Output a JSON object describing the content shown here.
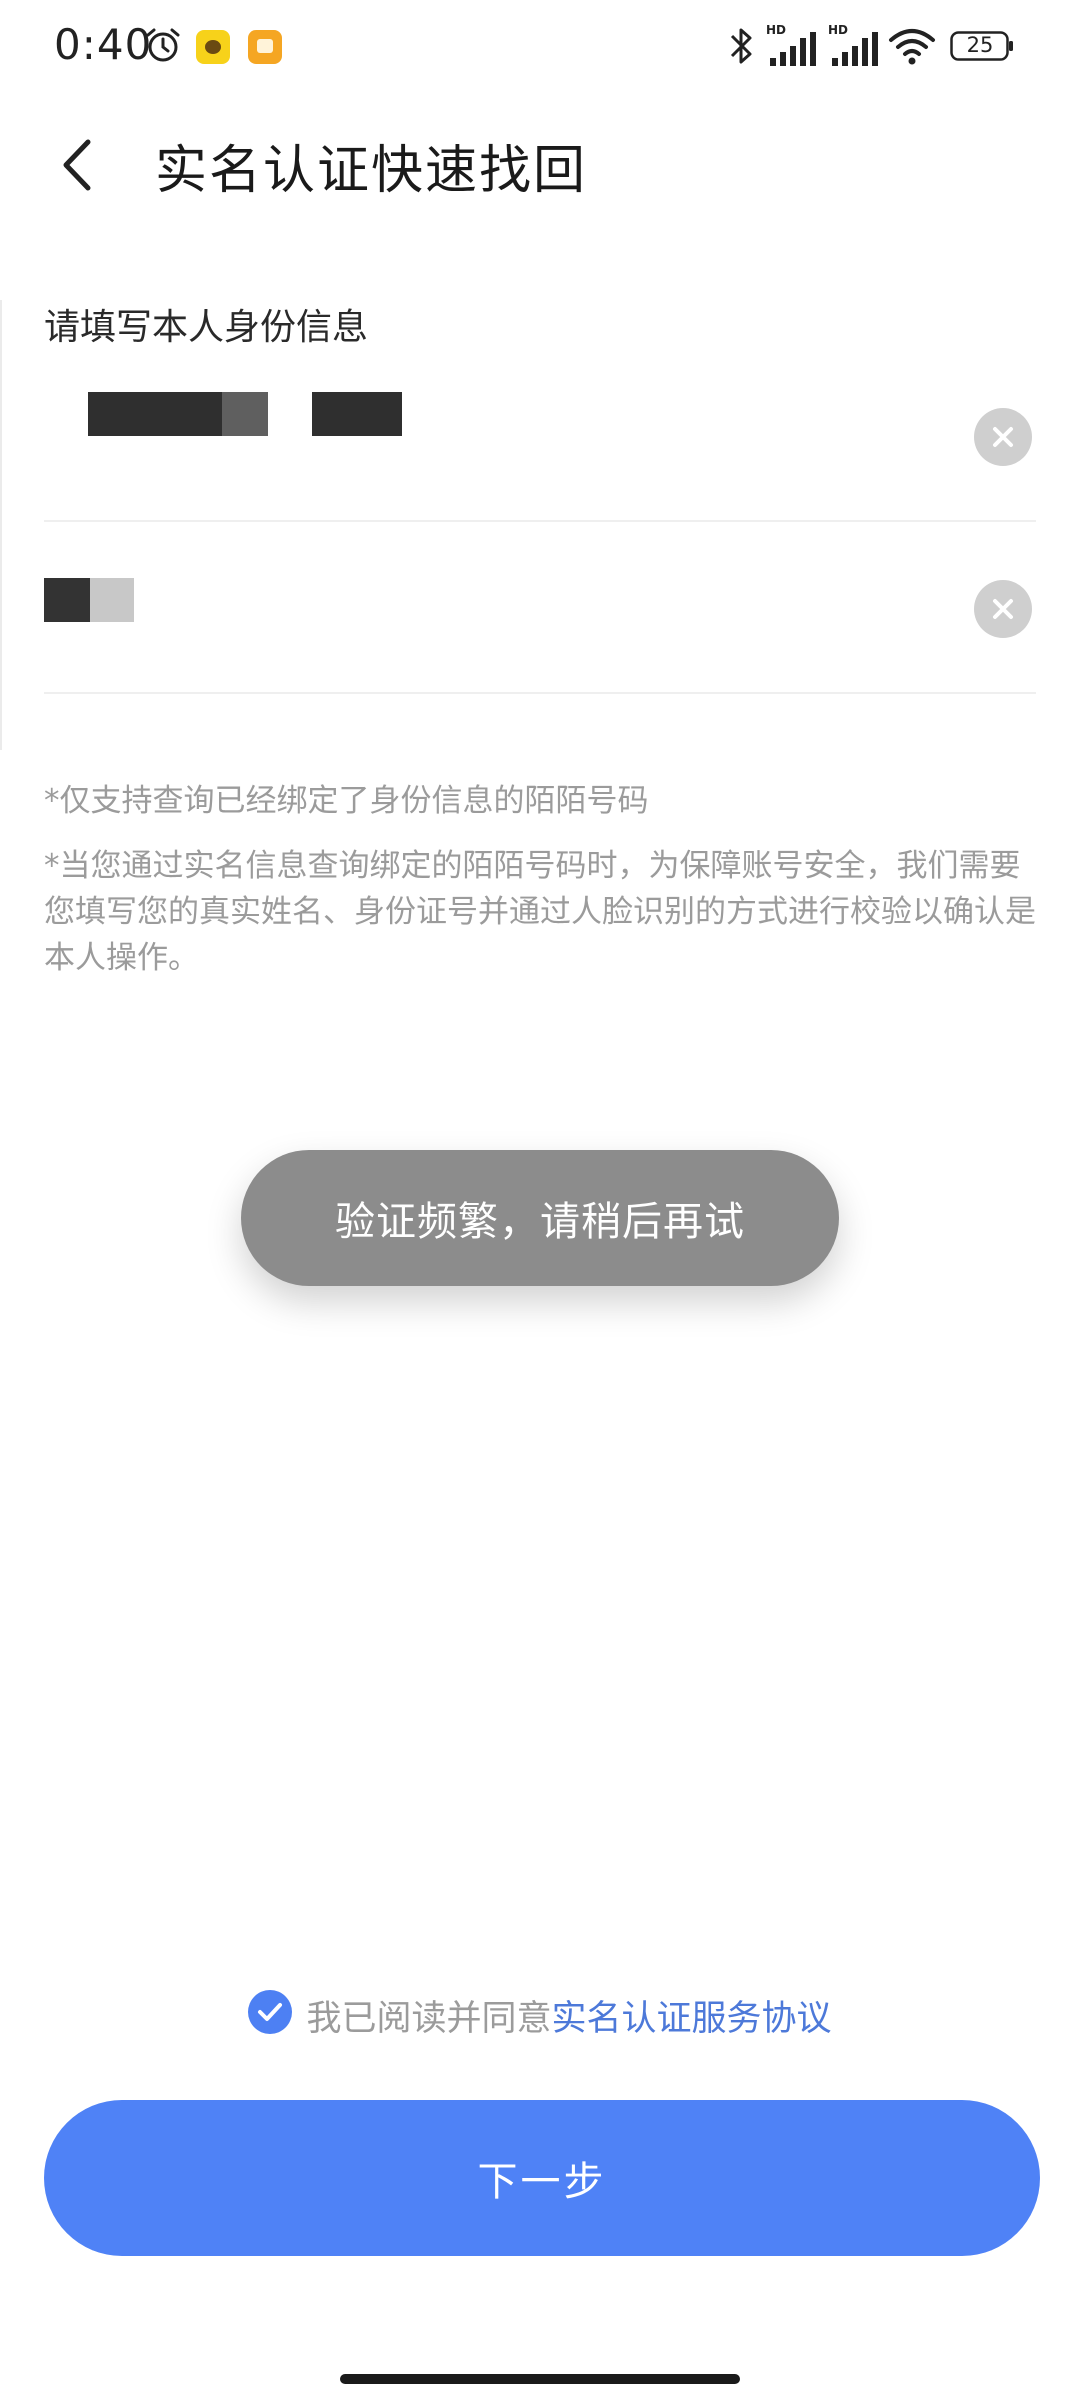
{
  "status_bar": {
    "time": "0:40",
    "battery": "25",
    "icons": [
      "alarm-icon",
      "app-notification-icon",
      "app-notification-icon",
      "bluetooth-icon",
      "hd-signal-icon",
      "hd-signal-icon",
      "wifi-icon",
      "battery-icon"
    ]
  },
  "header": {
    "title": "实名认证快速找回",
    "back_icon": "chevron-left-icon"
  },
  "form": {
    "section_label": "请填写本人身份信息",
    "name_field_state": "masked",
    "id_field_state": "masked",
    "clear_icon": "clear-icon"
  },
  "notes": [
    "*仅支持查询已经绑定了身份信息的陌陌号码",
    "*当您通过实名信息查询绑定的陌陌号码时，为保障账号安全，我们需要您填写您的真实姓名、身份证号并通过人脸识别的方式进行校验以确认是本人操作。"
  ],
  "toast": {
    "message": "验证频繁，请稍后再试"
  },
  "agreement": {
    "checked": true,
    "text": "我已阅读并同意",
    "link": "实名认证服务协议"
  },
  "next_button": {
    "label": "下一步"
  },
  "colors": {
    "accent": "#4f82f6",
    "link": "#4d79d9",
    "toast_bg": "#8c8c8c",
    "hint_text": "#9b9b9b"
  }
}
